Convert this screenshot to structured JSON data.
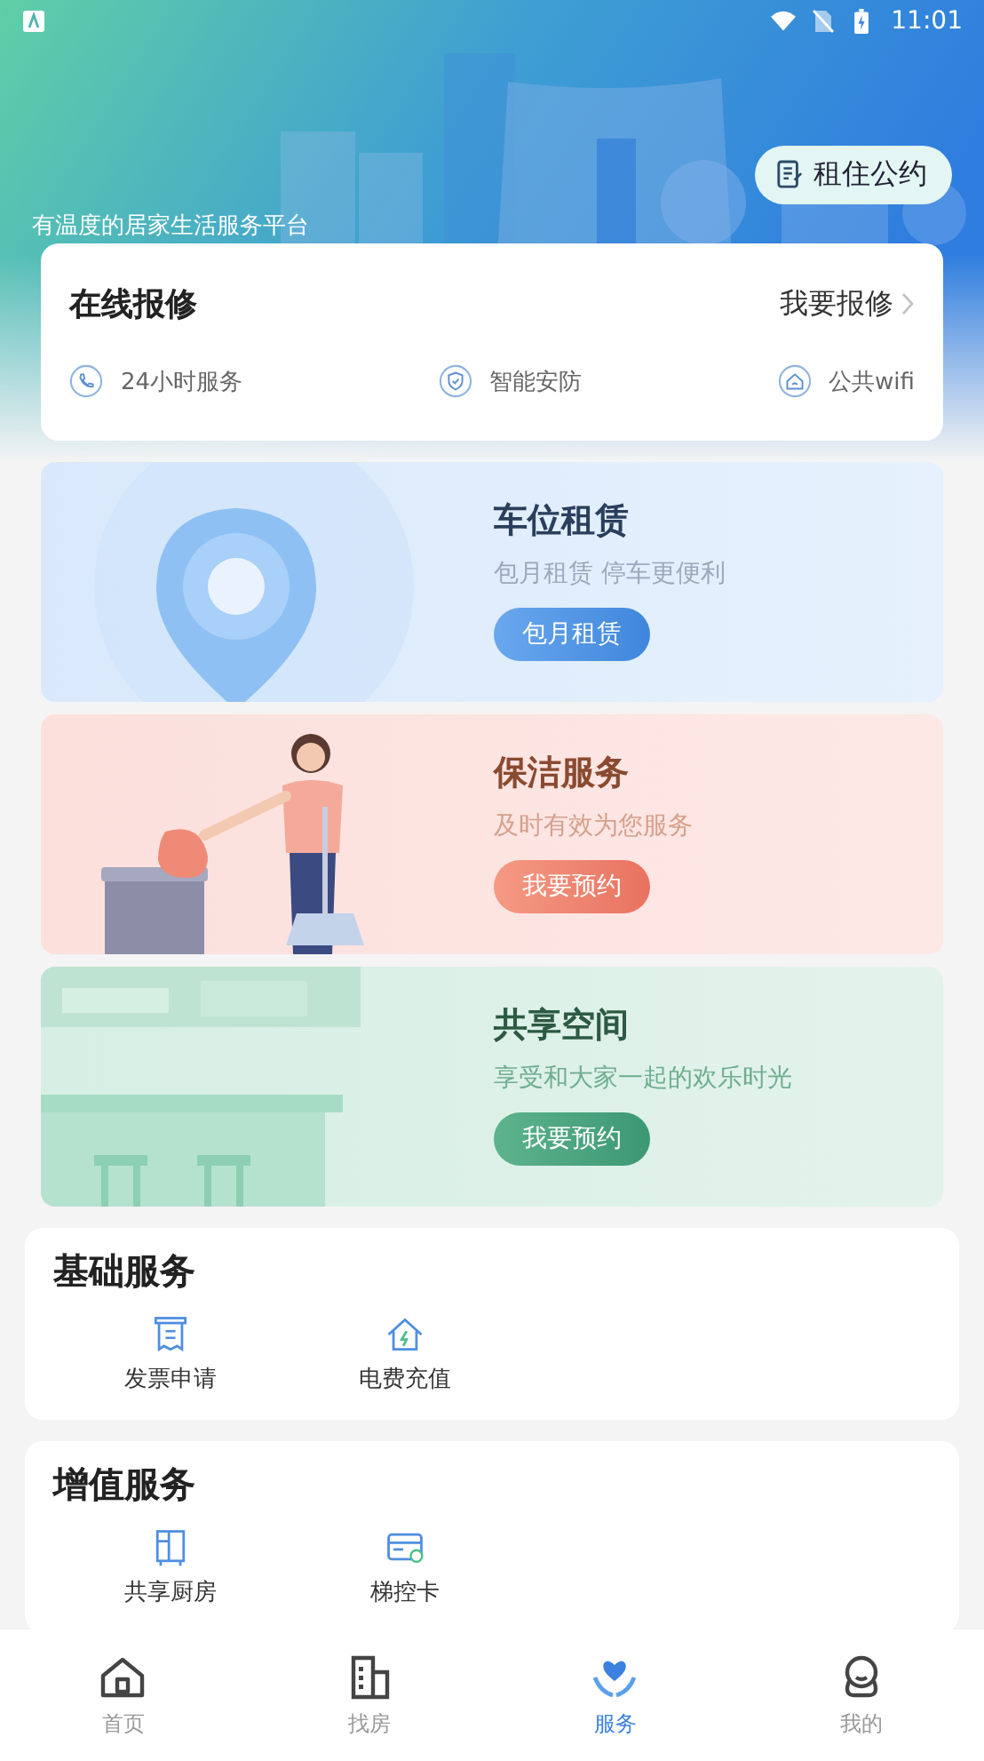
{
  "status_bar": {
    "time": "11:01"
  },
  "header": {
    "tagline": "有温度的居家生活服务平台",
    "agreement_button": "租住公约"
  },
  "repair": {
    "title": "在线报修",
    "action": "我要报修",
    "features": [
      {
        "label": "24小时服务"
      },
      {
        "label": "智能安防"
      },
      {
        "label": "公共wifi"
      }
    ]
  },
  "banners": [
    {
      "kind": "parking",
      "title": "车位租赁",
      "subtitle": "包月租赁 停车更便利",
      "button": "包月租赁"
    },
    {
      "kind": "cleaning",
      "title": "保洁服务",
      "subtitle": "及时有效为您服务",
      "button": "我要预约"
    },
    {
      "kind": "space",
      "title": "共享空间",
      "subtitle": "享受和大家一起的欢乐时光",
      "button": "我要预约"
    }
  ],
  "sections": [
    {
      "title": "基础服务",
      "items": [
        {
          "label": "发票申请"
        },
        {
          "label": "电费充值"
        }
      ]
    },
    {
      "title": "增值服务",
      "items": [
        {
          "label": "共享厨房"
        },
        {
          "label": "梯控卡"
        }
      ]
    }
  ],
  "bottom_nav": [
    {
      "label": "首页",
      "selected": false
    },
    {
      "label": "找房",
      "selected": false
    },
    {
      "label": "服务",
      "selected": true
    },
    {
      "label": "我的",
      "selected": false
    }
  ]
}
